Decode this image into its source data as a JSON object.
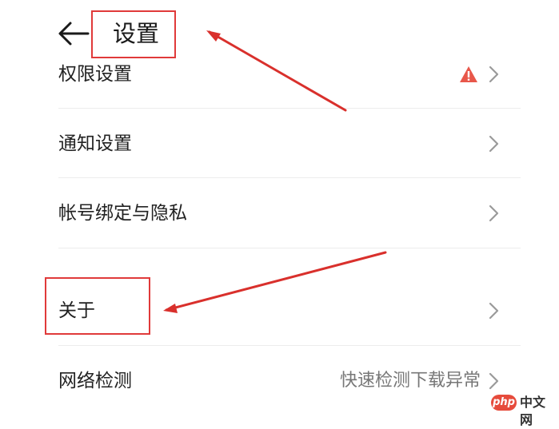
{
  "header": {
    "title": "设置",
    "back_icon": "arrow-left-icon"
  },
  "settings": {
    "permissions": {
      "label": "权限设置",
      "badge_icon": "warning-icon",
      "badge_color": "#e8574a"
    },
    "notifications": {
      "label": "通知设置"
    },
    "account": {
      "label": "帐号绑定与隐私"
    },
    "about": {
      "label": "关于"
    },
    "network": {
      "label": "网络检测",
      "value": "快速检测下载异常"
    }
  },
  "annotations": {
    "highlight_color": "#e03a3a",
    "arrow_color": "#d9302c"
  },
  "watermark": {
    "badge": "php",
    "text": "中文网"
  }
}
